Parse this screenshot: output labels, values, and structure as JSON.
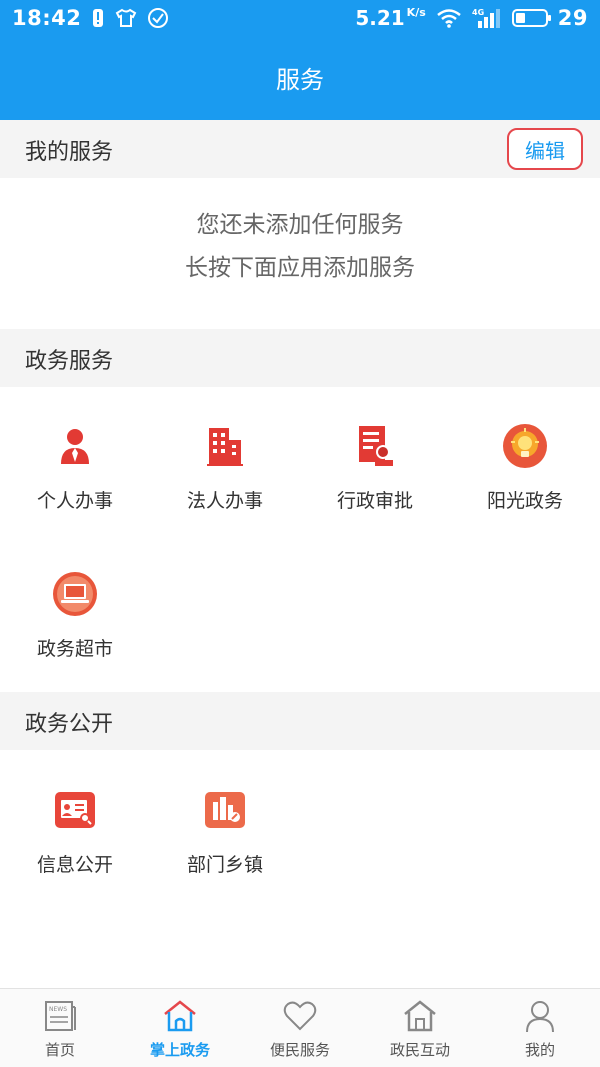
{
  "status_bar": {
    "time": "18:42",
    "speed": "5.21",
    "speed_unit": "K/s",
    "network": "4G",
    "battery": "29"
  },
  "header": {
    "title": "服务"
  },
  "my_services": {
    "title": "我的服务",
    "edit_label": "编辑",
    "empty_line1": "您还未添加任何服务",
    "empty_line2": "长按下面应用添加服务"
  },
  "gov_services": {
    "title": "政务服务",
    "items": [
      {
        "label": "个人办事",
        "icon": "person-icon"
      },
      {
        "label": "法人办事",
        "icon": "building-icon"
      },
      {
        "label": "行政审批",
        "icon": "document-stamp-icon"
      },
      {
        "label": "阳光政务",
        "icon": "lightbulb-icon"
      },
      {
        "label": "政务超市",
        "icon": "laptop-icon"
      }
    ]
  },
  "gov_open": {
    "title": "政务公开",
    "items": [
      {
        "label": "信息公开",
        "icon": "id-card-search-icon"
      },
      {
        "label": "部门乡镇",
        "icon": "city-buildings-icon"
      }
    ]
  },
  "bottom_nav": {
    "items": [
      {
        "label": "首页",
        "icon": "news-icon",
        "active": false
      },
      {
        "label": "掌上政务",
        "icon": "house-icon",
        "active": true
      },
      {
        "label": "便民服务",
        "icon": "heart-icon",
        "active": false
      },
      {
        "label": "政民互动",
        "icon": "house-outline-icon",
        "active": false
      },
      {
        "label": "我的",
        "icon": "user-icon",
        "active": false
      }
    ]
  },
  "colors": {
    "brand_blue": "#1a9bf0",
    "icon_red": "#e23a34",
    "edit_border": "#e5474c",
    "section_bg": "#f4f4f4"
  }
}
